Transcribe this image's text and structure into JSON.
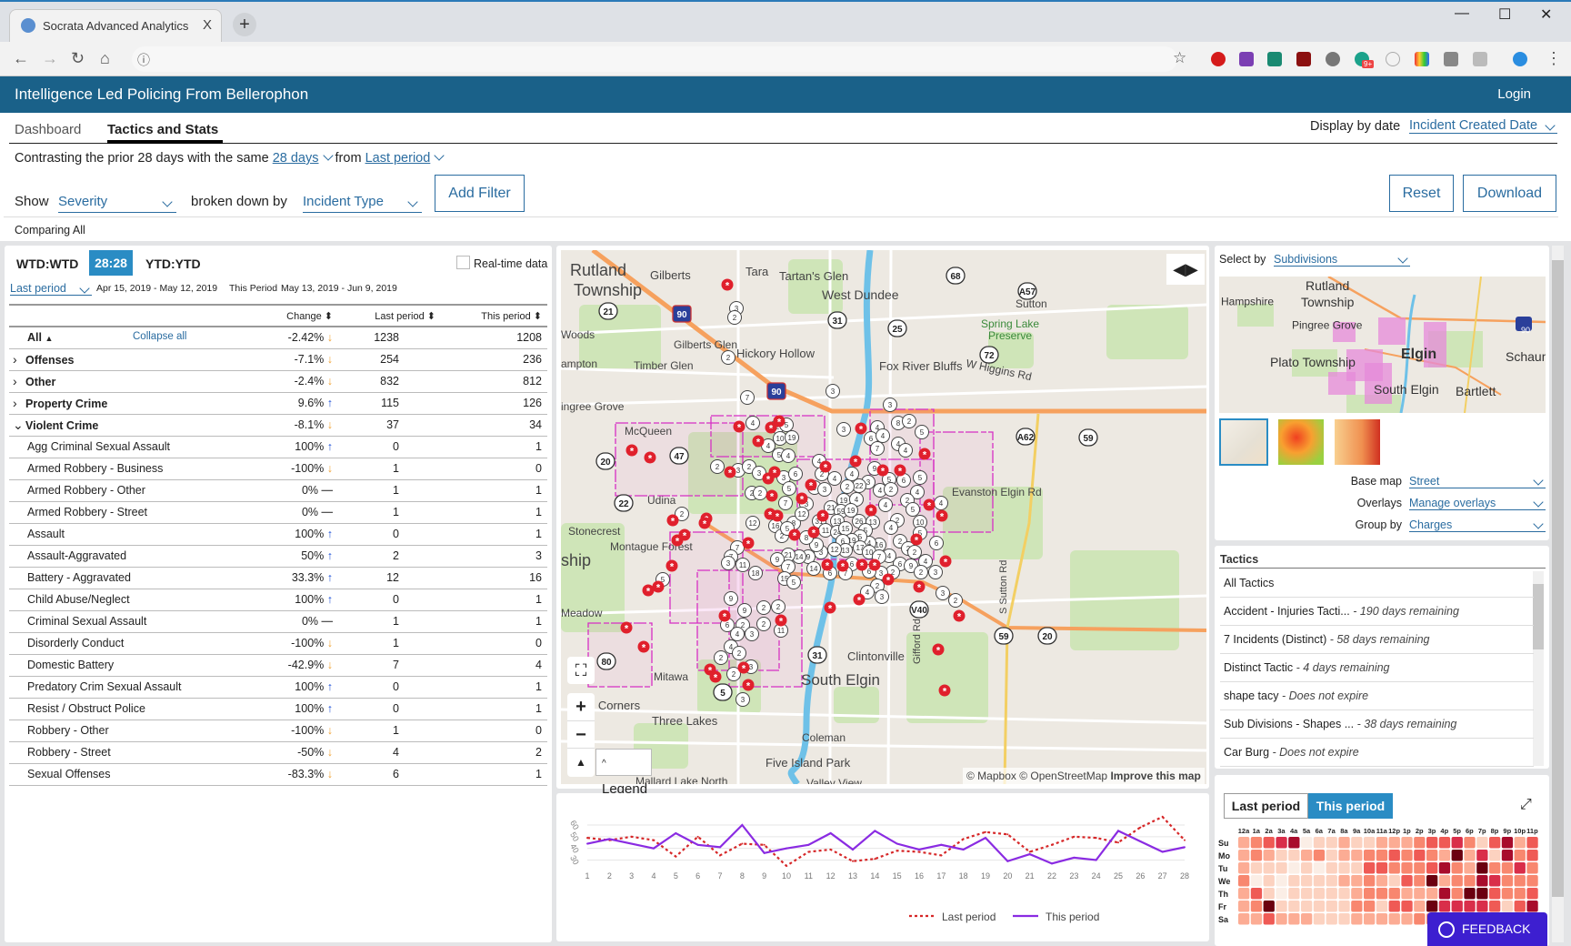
{
  "browser": {
    "tab_title": "Socrata Advanced Analytics",
    "close": "X",
    "new_tab": "+",
    "minimize": "—",
    "maximize": "☐",
    "close_window": "✕",
    "ext_badge": "9+"
  },
  "app": {
    "title": "Intelligence Led Policing From Bellerophon",
    "login": "Login"
  },
  "tabs": [
    {
      "label": "Dashboard",
      "active": false
    },
    {
      "label": "Tactics and Stats",
      "active": true
    }
  ],
  "display_by_date": {
    "label": "Display by date",
    "value": "Incident Created Date"
  },
  "contrast": {
    "prefix": "Contrasting the prior 28 days with the same",
    "period": "28 days",
    "from": "from",
    "compare": "Last period"
  },
  "filters": {
    "show_label": "Show",
    "show_value": "Severity",
    "broken_label": "broken down by",
    "broken_value": "Incident Type",
    "add_filter": "Add Filter",
    "reset": "Reset",
    "download": "Download"
  },
  "comparing": "Comparing All",
  "stats": {
    "modes": [
      {
        "label": "WTD:WTD",
        "active": false
      },
      {
        "label": "28:28",
        "active": true
      },
      {
        "label": "YTD:YTD",
        "active": false
      }
    ],
    "realtime_label": "Real-time data",
    "realtime_checked": false,
    "period_select": "Last period",
    "last_range": "Apr 15, 2019 - May 12, 2019",
    "this_label": "This Period",
    "this_range": "May 13, 2019 - Jun 9, 2019",
    "columns": {
      "change": "Change",
      "last": "Last period",
      "this": "This period"
    },
    "collapse_all": "Collapse all",
    "rows": [
      {
        "name": "All",
        "change": "-2.42%",
        "dir": "down",
        "last": "1238",
        "this": "1208",
        "level": "all"
      },
      {
        "name": "Offenses",
        "change": "-7.1%",
        "dir": "down",
        "last": "254",
        "this": "236",
        "level": "collapsed"
      },
      {
        "name": "Other",
        "change": "-2.4%",
        "dir": "down",
        "last": "832",
        "this": "812",
        "level": "collapsed"
      },
      {
        "name": "Property Crime",
        "change": "9.6%",
        "dir": "up",
        "last": "115",
        "this": "126",
        "level": "collapsed"
      },
      {
        "name": "Violent Crime",
        "change": "-8.1%",
        "dir": "down",
        "last": "37",
        "this": "34",
        "level": "expanded"
      },
      {
        "name": "Agg Criminal Sexual Assault",
        "change": "100%",
        "dir": "up",
        "last": "0",
        "this": "1",
        "level": "child"
      },
      {
        "name": "Armed Robbery - Business",
        "change": "-100%",
        "dir": "down",
        "last": "1",
        "this": "0",
        "level": "child"
      },
      {
        "name": "Armed Robbery - Other",
        "change": "0%",
        "dir": "flat",
        "last": "1",
        "this": "1",
        "level": "child"
      },
      {
        "name": "Armed Robbery - Street",
        "change": "0%",
        "dir": "flat",
        "last": "1",
        "this": "1",
        "level": "child"
      },
      {
        "name": "Assault",
        "change": "100%",
        "dir": "up",
        "last": "0",
        "this": "1",
        "level": "child"
      },
      {
        "name": "Assault-Aggravated",
        "change": "50%",
        "dir": "up",
        "last": "2",
        "this": "3",
        "level": "child"
      },
      {
        "name": "Battery - Aggravated",
        "change": "33.3%",
        "dir": "up",
        "last": "12",
        "this": "16",
        "level": "child"
      },
      {
        "name": "Child Abuse/Neglect",
        "change": "100%",
        "dir": "up",
        "last": "0",
        "this": "1",
        "level": "child"
      },
      {
        "name": "Criminal Sexual Assault",
        "change": "0%",
        "dir": "flat",
        "last": "1",
        "this": "1",
        "level": "child"
      },
      {
        "name": "Disorderly Conduct",
        "change": "-100%",
        "dir": "down",
        "last": "1",
        "this": "0",
        "level": "child"
      },
      {
        "name": "Domestic Battery",
        "change": "-42.9%",
        "dir": "down",
        "last": "7",
        "this": "4",
        "level": "child"
      },
      {
        "name": "Predatory Crim Sexual Assault",
        "change": "100%",
        "dir": "up",
        "last": "0",
        "this": "1",
        "level": "child"
      },
      {
        "name": "Resist / Obstruct Police",
        "change": "100%",
        "dir": "up",
        "last": "0",
        "this": "1",
        "level": "child"
      },
      {
        "name": "Robbery - Other",
        "change": "-100%",
        "dir": "down",
        "last": "1",
        "this": "0",
        "level": "child"
      },
      {
        "name": "Robbery - Street",
        "change": "-50%",
        "dir": "down",
        "last": "4",
        "this": "2",
        "level": "child"
      },
      {
        "name": "Sexual Offenses",
        "change": "-83.3%",
        "dir": "down",
        "last": "6",
        "this": "1",
        "level": "child"
      }
    ]
  },
  "map": {
    "labels": [
      "Rutland",
      "Township",
      "Gilberts",
      "Tara",
      "Tartan's Glen",
      "West Dundee",
      "Woods",
      "Gilberts Glen",
      "Hickory Hollow",
      "Timber Glen",
      "ampton",
      "Fox River Bluffs",
      "W Higgins Rd",
      "Spring Lake",
      "Preserve",
      "Sutton",
      "ingree Grove",
      "McQueen",
      "Udina",
      "Evanston Elgin Rd",
      "Stonecrest",
      "Montague Forest",
      "ship",
      "Meadow",
      "Mitawa",
      "South Elgin",
      "Clintonville",
      "Gifford Rd",
      "S Sutton Rd",
      "o Corners",
      "Three Lakes",
      "Coleman",
      "Five Island Park",
      "Mallard Lake North",
      "Valley View"
    ],
    "shields": [
      "90",
      "90",
      "21",
      "47",
      "22",
      "20",
      "31",
      "25",
      "68",
      "72",
      "A57",
      "A62",
      "59",
      "59",
      "V40",
      "31",
      "80",
      "5",
      "20"
    ],
    "clusters": [
      "3",
      "2",
      "2",
      "7",
      "3",
      "3",
      "4",
      "2",
      "5",
      "10",
      "19",
      "4",
      "5",
      "4",
      "2",
      "3",
      "2",
      "3",
      "3",
      "6",
      "4",
      "2",
      "4",
      "4",
      "3",
      "4",
      "6",
      "4",
      "7",
      "8",
      "2",
      "5",
      "4",
      "4",
      "5",
      "9",
      "5",
      "3",
      "22",
      "2",
      "4",
      "2",
      "6",
      "4",
      "5",
      "9",
      "3",
      "2",
      "2",
      "7",
      "3",
      "19",
      "4",
      "4",
      "2",
      "4",
      "21",
      "59",
      "19",
      "5",
      "2",
      "12",
      "16",
      "8",
      "12",
      "31",
      "11",
      "13",
      "24",
      "15",
      "26",
      "13",
      "5",
      "2",
      "4",
      "10",
      "5",
      "6",
      "2",
      "2",
      "2",
      "4",
      "6",
      "9",
      "2",
      "3",
      "2",
      "3",
      "4",
      "16",
      "4",
      "5",
      "19",
      "6",
      "13",
      "12",
      "17",
      "10",
      "7",
      "6",
      "6",
      "7",
      "6",
      "3",
      "9",
      "9",
      "14",
      "21",
      "9",
      "7",
      "14",
      "15",
      "5",
      "2",
      "5",
      "8",
      "7",
      "7",
      "3",
      "11",
      "18",
      "2",
      "3",
      "4",
      "3",
      "2",
      "9",
      "9",
      "2",
      "2",
      "6",
      "2",
      "2",
      "4",
      "3",
      "11",
      "4",
      "2",
      "2",
      "3",
      "2",
      "3",
      "5"
    ],
    "legend": "Legend",
    "attribution": "© Mapbox © OpenStreetMap",
    "improve": "Improve this map"
  },
  "map_options": {
    "select_by_label": "Select by",
    "select_by_value": "Subdivisions",
    "mini_labels": [
      "Rutland",
      "Township",
      "Hampshire",
      "Pingree Grove",
      "Elgin",
      "Plato Township",
      "Schaum",
      "South Elgin",
      "Bartlett",
      "90"
    ],
    "base_map_label": "Base map",
    "base_map_value": "Street",
    "overlays_label": "Overlays",
    "overlays_value": "Manage overlays",
    "group_by_label": "Group by",
    "group_by_value": "Charges"
  },
  "tactics": {
    "title": "Tactics",
    "items": [
      {
        "name": "All Tactics",
        "note": ""
      },
      {
        "name": "Accident - Injuries Tacti...",
        "note": "- 190 days remaining"
      },
      {
        "name": "7 Incidents (Distinct)",
        "note": "- 58 days remaining"
      },
      {
        "name": "Distinct Tactic",
        "note": "- 4 days remaining"
      },
      {
        "name": "shape tacy",
        "note": "- Does not expire"
      },
      {
        "name": "Sub Divisions - Shapes ...",
        "note": "- 38 days remaining"
      },
      {
        "name": "Car Burg",
        "note": "- Does not expire"
      }
    ]
  },
  "chart_data": {
    "type": "line",
    "x": [
      1,
      2,
      3,
      4,
      5,
      6,
      7,
      8,
      9,
      10,
      11,
      12,
      13,
      14,
      15,
      16,
      17,
      18,
      19,
      20,
      21,
      22,
      23,
      24,
      25,
      26,
      27,
      28
    ],
    "yticks": [
      30,
      40,
      50,
      60
    ],
    "ylim": [
      22,
      70
    ],
    "grid": true,
    "legend_position": "bottom-right",
    "series": [
      {
        "name": "Last period",
        "style": "dotted",
        "color": "#d62728",
        "values": [
          49,
          47,
          50,
          47,
          33,
          50,
          34,
          44,
          43,
          25,
          37,
          39,
          29,
          31,
          38,
          37,
          34,
          48,
          54,
          52,
          37,
          43,
          50,
          49,
          45,
          58,
          67,
          47
        ]
      },
      {
        "name": "This period",
        "style": "solid",
        "color": "#8a2be2",
        "values": [
          44,
          48,
          44,
          40,
          53,
          43,
          41,
          60,
          36,
          40,
          43,
          53,
          39,
          55,
          44,
          39,
          43,
          39,
          49,
          29,
          35,
          27,
          32,
          30,
          55,
          46,
          37,
          41
        ]
      }
    ]
  },
  "heatmap": {
    "toggle": [
      {
        "label": "Last period",
        "active": false
      },
      {
        "label": "This period",
        "active": true
      }
    ],
    "hours": [
      "12a",
      "1a",
      "2a",
      "3a",
      "4a",
      "5a",
      "6a",
      "7a",
      "8a",
      "9a",
      "10a",
      "11a",
      "12p",
      "1p",
      "2p",
      "3p",
      "4p",
      "5p",
      "6p",
      "7p",
      "8p",
      "9p",
      "10p",
      "11p"
    ],
    "days": [
      "Su",
      "Mo",
      "Tu",
      "We",
      "Th",
      "Fr",
      "Sa"
    ],
    "intensity": [
      [
        2,
        3,
        4,
        5,
        6,
        0,
        1,
        1,
        2,
        1,
        1,
        2,
        2,
        2,
        3,
        4,
        4,
        5,
        3,
        1,
        4,
        6,
        2,
        4
      ],
      [
        2,
        3,
        2,
        1,
        1,
        2,
        3,
        1,
        2,
        2,
        3,
        3,
        4,
        3,
        4,
        3,
        2,
        7,
        2,
        5,
        1,
        6,
        3,
        4
      ],
      [
        2,
        1,
        1,
        1,
        0,
        1,
        0,
        1,
        1,
        1,
        4,
        4,
        3,
        3,
        3,
        4,
        6,
        3,
        2,
        7,
        3,
        3,
        5,
        3
      ],
      [
        3,
        0,
        1,
        0,
        1,
        1,
        1,
        1,
        2,
        2,
        3,
        2,
        1,
        4,
        3,
        7,
        2,
        3,
        3,
        6,
        5,
        3,
        3,
        3
      ],
      [
        2,
        4,
        1,
        0,
        1,
        1,
        1,
        1,
        1,
        2,
        3,
        3,
        3,
        2,
        2,
        2,
        6,
        3,
        7,
        7,
        4,
        3,
        3,
        4
      ],
      [
        2,
        3,
        7,
        1,
        1,
        1,
        1,
        1,
        1,
        3,
        3,
        1,
        4,
        4,
        2,
        7,
        5,
        5,
        5,
        5,
        4,
        1,
        4,
        6
      ],
      [
        2,
        2,
        4,
        2,
        2,
        2,
        1,
        1,
        1,
        2,
        2,
        2,
        2,
        2,
        3,
        3,
        3,
        3,
        3,
        3,
        3,
        3,
        3,
        3
      ]
    ],
    "palette": [
      "#fbeee6",
      "#fcd2c0",
      "#fcac94",
      "#f8876f",
      "#ef5a55",
      "#d92e4a",
      "#a80c2c",
      "#6b0010"
    ]
  },
  "feedback": "FEEDBACK",
  "colors": {
    "header": "#1a6189",
    "accent": "#2a8cc4",
    "link": "#2a6ca0",
    "feedback": "#3d1fd0",
    "up": "#1b4fd6",
    "down": "#f0a030"
  }
}
